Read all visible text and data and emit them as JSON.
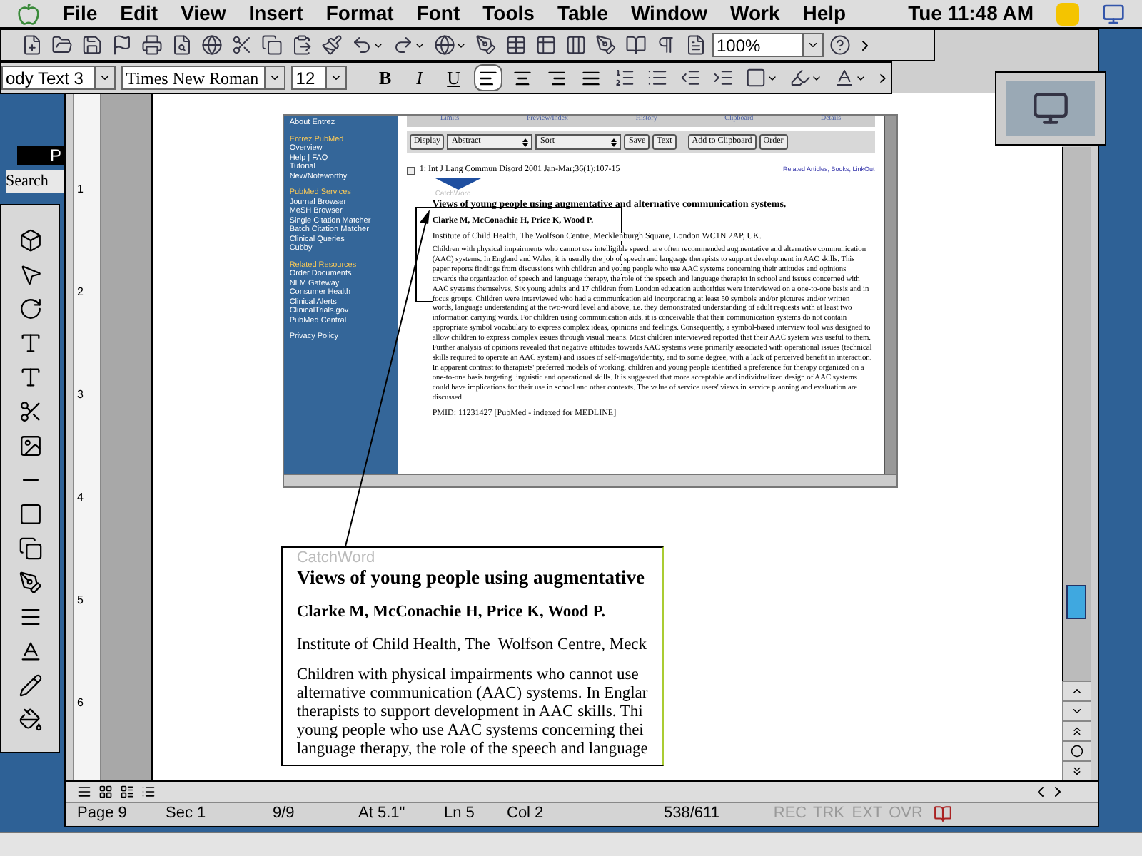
{
  "menu_bar": {
    "items": [
      "File",
      "Edit",
      "View",
      "Insert",
      "Format",
      "Font",
      "Tools",
      "Table",
      "Window",
      "Work",
      "Help"
    ],
    "clock": "Tue 11:48 AM"
  },
  "standard_toolbar": {
    "zoom": "100%"
  },
  "formatting_toolbar": {
    "style": "ody Text 3",
    "font": "Times New Roman",
    "size": "12",
    "text_styles": [
      {
        "label": "B",
        "selected": false
      },
      {
        "label": "I",
        "selected": false
      },
      {
        "label": "U",
        "selected": false
      }
    ],
    "alignment": [
      {
        "kind": "left",
        "selected": true
      },
      {
        "kind": "center",
        "selected": false
      },
      {
        "kind": "right",
        "selected": false
      },
      {
        "kind": "justify",
        "selected": false
      }
    ]
  },
  "background_window": {
    "texts": [
      "P",
      "Search"
    ]
  },
  "ruler": {
    "marks": [
      "1",
      "2",
      "3",
      "4",
      "5",
      "6"
    ]
  },
  "pasted_screenshot": {
    "tabs": [
      "Limits",
      "Preview/Index",
      "History",
      "Clipboard",
      "Details"
    ],
    "sidebar": [
      {
        "title": "About Entrez"
      },
      {
        "title": "Entrez PubMed",
        "items": [
          "Overview",
          "Help | FAQ",
          "Tutorial",
          "New/Noteworthy"
        ]
      },
      {
        "title": "PubMed Services",
        "items": [
          "Journal Browser",
          "MeSH Browser",
          "Single Citation Matcher",
          "Batch Citation Matcher",
          "Clinical Queries",
          "Cubby"
        ]
      },
      {
        "title": "Related Resources",
        "items": [
          "Order Documents",
          "NLM Gateway",
          "Consumer Health",
          "Clinical Alerts",
          "ClinicalTrials.gov",
          "PubMed Central"
        ]
      },
      {
        "title": "Privacy Policy"
      }
    ],
    "controls": [
      {
        "kind": "button",
        "label": "Display"
      },
      {
        "kind": "select",
        "label": "Abstract"
      },
      {
        "kind": "select",
        "label": "Sort"
      },
      {
        "kind": "button",
        "label": "Save"
      },
      {
        "kind": "button",
        "label": "Text"
      },
      {
        "kind": "button",
        "label": "Add to Clipboard"
      },
      {
        "kind": "button",
        "label": "Order"
      }
    ],
    "citation_checked": false,
    "citation": "1: Int J Lang Commun Disord 2001 Jan-Mar;36(1):107-15",
    "related_links": "Related Articles, Books, LinkOut",
    "logo": "CatchWord",
    "title": "Views of young people using augmentative and alternative communication systems.",
    "authors": "Clarke M, McConachie H, Price K, Wood P.",
    "affiliation": "Institute of Child Health, The Wolfson Centre, Mecklenburgh Square, London WC1N 2AP, UK.",
    "abstract": "Children with physical impairments who cannot use intelligible speech are often recommended augmentative and alternative communication (AAC) systems. In England and Wales, it is usually the job of speech and language therapists to support development in AAC skills. This paper reports findings from discussions with children and young people who use AAC systems concerning their attitudes and opinions towards the organization of speech and language therapy, the role of the speech and language therapist in school and issues concerned with AAC systems themselves. Six young adults and 17 children from London education authorities were interviewed on a one-to-one basis and in focus groups. Children were interviewed who had a communication aid incorporating at least 50 symbols and/or pictures and/or written words, language understanding at the two-word level and above, i.e. they demonstrated understanding of adult requests with at least two information carrying words. For children using communication aids, it is conceivable that their communication systems do not contain appropriate symbol vocabulary to express complex ideas, opinions and feelings. Consequently, a symbol-based interview tool was designed to allow children to express complex issues through visual means. Most children interviewed reported that their AAC system was useful to them. Further analysis of opinions revealed that negative attitudes towards AAC systems were primarily associated with operational issues (technical skills required to operate an AAC system) and issues of self-image/identity, and to some degree, with a lack of perceived benefit in interaction. In apparent contrast to therapists' preferred models of working, children and young people identified a preference for therapy organized on a one-to-one basis targeting linguistic and operational skills. It is suggested that more acceptable and individualized design of AAC systems could have implications for their use in school and other contexts. The value of service users' views in service planning and evaluation are discussed.",
    "pmid": "PMID: 11231427 [PubMed - indexed for MEDLINE]"
  },
  "text_box": {
    "logo": "CatchWord",
    "title": "Views of young people using augmentative",
    "authors": "Clarke M, McConachie H, Price K, Wood P.",
    "affiliation": "Institute of Child Health, The  Wolfson Centre, Meck",
    "abstract_lines": [
      "Children with physical impairments who cannot use",
      "alternative communication (AAC) systems. In Englar",
      "therapists to support development in AAC skills. Thi",
      "young people who use AAC systems concerning thei",
      "language therapy, the role of the speech and language"
    ]
  },
  "status_bar": {
    "page": "Page 9",
    "section": "Sec 1",
    "pages": "9/9",
    "at": "At 5.1\"",
    "line": "Ln 5",
    "column": "Col 2",
    "words": "538/611",
    "modes": [
      {
        "label": "REC",
        "on": false
      },
      {
        "label": "TRK",
        "on": false
      },
      {
        "label": "EXT",
        "on": false
      },
      {
        "label": "OVR",
        "on": false
      }
    ]
  }
}
